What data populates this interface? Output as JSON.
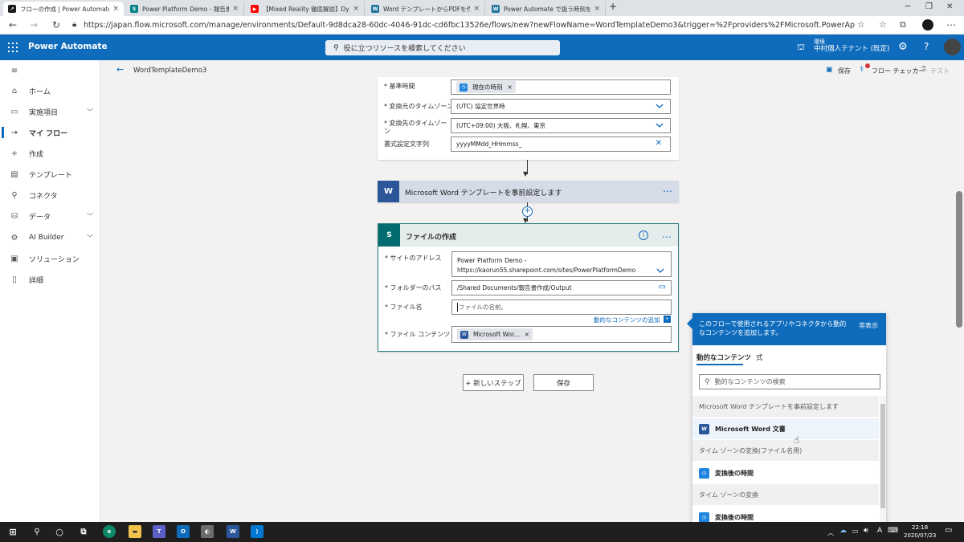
{
  "browser": {
    "tabs": [
      {
        "title": "フローの作成 | Power Automate",
        "color": "#1d1d1d",
        "glyph": "↗"
      },
      {
        "title": "Power Platform Demo - 報告書作成",
        "color": "#038387",
        "glyph": "S"
      },
      {
        "title": "【Mixed Reality 徹底解説】Dynami…",
        "color": "#ff0000",
        "glyph": "▶"
      },
      {
        "title": "Word テンプレートからPDFを作成する…",
        "color": "#21759b",
        "glyph": "W"
      },
      {
        "title": "Power Automate で扱う時刻を日本…",
        "color": "#21759b",
        "glyph": "W"
      }
    ],
    "new_tab": "+",
    "url": "https://japan.flow.microsoft.com/manage/environments/Default-9d8dca28-60dc-4046-91dc-cd6fbc13526e/flows/new?newFlowName=WordTemplateDemo3&trigger=%2Fproviders%2FMicrosoft.PowerApps%2F..."
  },
  "header": {
    "brand": "Power Automate",
    "search_placeholder": "役に立つリソースを検索してください",
    "env_label": "環境",
    "env_name": "中村個人テナント (既定)"
  },
  "sidebar": {
    "items": [
      {
        "label": "ホーム",
        "icon": "home-icon",
        "glyph": "⌂",
        "chevron": false
      },
      {
        "label": "実施項目",
        "icon": "clipboard-icon",
        "glyph": "▭",
        "chevron": true
      },
      {
        "label": "マイ フロー",
        "icon": "flow-icon",
        "glyph": "⇢",
        "chevron": false,
        "selected": true
      },
      {
        "label": "作成",
        "icon": "plus-icon",
        "glyph": "+",
        "chevron": false
      },
      {
        "label": "テンプレート",
        "icon": "template-icon",
        "glyph": "▤",
        "chevron": false
      },
      {
        "label": "コネクタ",
        "icon": "connector-icon",
        "glyph": "⚲",
        "chevron": false
      },
      {
        "label": "データ",
        "icon": "database-icon",
        "glyph": "⛁",
        "chevron": true
      },
      {
        "label": "AI Builder",
        "icon": "ai-builder-icon",
        "glyph": "⚙",
        "chevron": true
      },
      {
        "label": "ソリューション",
        "icon": "solution-icon",
        "glyph": "▣",
        "chevron": false
      },
      {
        "label": "詳細",
        "icon": "book-icon",
        "glyph": "▯",
        "chevron": false
      }
    ]
  },
  "cmdbar": {
    "flow_name": "WordTemplateDemo3",
    "save": "保存",
    "flow_checker": "フロー チェッカー",
    "test": "テスト"
  },
  "timezone_card": {
    "base_time_label": "* 基準時間",
    "base_time_token": "現在の時刻",
    "src_tz_label": "* 変換元のタイムゾーン",
    "src_tz_value": "(UTC) 協定世界時",
    "dst_tz_label": "* 変換先のタイムゾーン",
    "dst_tz_value": "(UTC+09:00) 大阪、札幌、東京",
    "format_label": "書式設定文字列",
    "format_value": "yyyyMMdd_HHmmss_"
  },
  "word_card": {
    "title": "Microsoft Word テンプレートを事前設定します",
    "more": "…"
  },
  "file_card": {
    "title": "ファイルの作成",
    "more": "…",
    "site_label": "* サイトのアドレス",
    "site_line1": "Power Platform Demo -",
    "site_line2": "https://kaorun55.sharepoint.com/sites/PowerPlatformDemo",
    "folder_label": "* フォルダーのパス",
    "folder_value": "/Shared Documents/報告書作成/Output",
    "filename_label": "* ファイル名",
    "filename_placeholder": "ファイルの名前。",
    "dynamic_add": "動的なコンテンツの追加",
    "content_label": "* ファイル コンテンツ",
    "content_token": "Microsoft Wor..."
  },
  "buttons": {
    "new_step": "+ 新しいステップ",
    "save": "保存"
  },
  "dynamic_panel": {
    "header_text": "このフローで使用されるアプリやコネクタから動的なコンテンツを追加します。",
    "hide": "非表示",
    "tab_dynamic": "動的なコンテンツ",
    "tab_expression": "式",
    "search_placeholder": "動的なコンテンツの検索",
    "section1": "Microsoft Word テンプレートを事前設定します",
    "item1": "Microsoft Word 文書",
    "section2": "タイム ゾーンの変換(ファイル名用)",
    "item2": "変換後の時間",
    "section3": "タイム ゾーンの変換",
    "item3": "変換後の時間"
  },
  "taskbar": {
    "time": "22:18",
    "date": "2020/07/23",
    "ime": "A"
  },
  "colors": {
    "brand": "#0f6cbd",
    "word": "#2b579a",
    "sharepoint": "#036c70",
    "clock": "#1f85de"
  }
}
